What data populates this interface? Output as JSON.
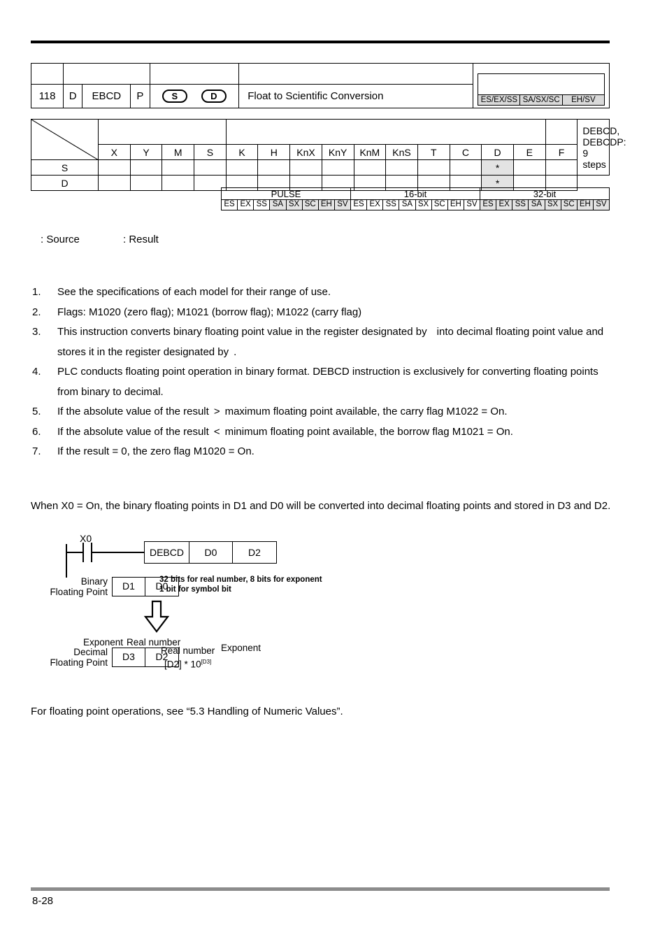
{
  "header": {
    "number": "118",
    "d_flag": "D",
    "mnemonic": "EBCD",
    "p_flag": "P",
    "operand_s": "S",
    "operand_d": "D",
    "description": "Float to Scientific Conversion",
    "model_groups": [
      "ES/EX/SS",
      "SA/SX/SC",
      "EH/SV"
    ]
  },
  "operand_table": {
    "columns": [
      "X",
      "Y",
      "M",
      "S",
      "K",
      "H",
      "KnX",
      "KnY",
      "KnM",
      "KnS",
      "T",
      "C",
      "D",
      "E",
      "F"
    ],
    "steps_note": "DEBCD, DEBCDP: 9 steps",
    "rows": [
      {
        "label": "S",
        "marks": [
          "",
          "",
          "",
          "",
          "",
          "",
          "",
          "",
          "",
          "",
          "",
          "",
          "*",
          "",
          ""
        ]
      },
      {
        "label": "D",
        "marks": [
          "",
          "",
          "",
          "",
          "",
          "",
          "",
          "",
          "",
          "",
          "",
          "",
          "*",
          "",
          ""
        ]
      }
    ]
  },
  "pulse_table": {
    "groups": [
      "PULSE",
      "16-bit",
      "32-bit"
    ],
    "models": [
      "ES",
      "EX",
      "SS",
      "SA",
      "SX",
      "SC",
      "EH",
      "SV"
    ],
    "shading": {
      "PULSE": [
        false,
        false,
        false,
        true,
        true,
        true,
        true,
        true
      ],
      "16-bit": [
        false,
        false,
        false,
        false,
        false,
        false,
        false,
        false
      ],
      "32-bit": [
        true,
        true,
        true,
        true,
        true,
        true,
        true,
        true
      ]
    }
  },
  "legend": {
    "source": ": Source",
    "result": ": Result"
  },
  "notes": [
    {
      "num": "1.",
      "text": "See the specifications of each model for their range of use."
    },
    {
      "num": "2.",
      "text": "Flags: M1020 (zero flag); M1021 (borrow flag); M1022 (carry flag)"
    },
    {
      "num": "3.",
      "text_a": "This instruction converts binary floating point value in the register designated by",
      "text_b": "into decimal floating point value and stores it in the register designated by",
      "text_c": "."
    },
    {
      "num": "4.",
      "text": "PLC conducts floating point operation in binary format. DEBCD instruction is exclusively for converting floating points from binary to decimal."
    },
    {
      "num": "5.",
      "text_a": "If the absolute value of the result",
      "symbol": ">",
      "text_b": "maximum floating point available, the carry flag M1022 = On."
    },
    {
      "num": "6.",
      "text_a": "If the absolute value of the result",
      "symbol": "<",
      "text_b": "minimum floating point available, the borrow flag M1021 = On."
    },
    {
      "num": "7.",
      "text": "If the result = 0, the zero flag M1020 = On."
    }
  ],
  "example": {
    "paragraph": "When X0 = On, the binary floating points in D1 and D0 will be converted into decimal floating points and stored in D3 and D2.",
    "contact_label": "X0",
    "instruction": {
      "opcode": "DEBCD",
      "operand1": "D0",
      "operand2": "D2"
    },
    "binary": {
      "label_line1": "Binary",
      "label_line2": "Floating Point",
      "reg_high": "D1",
      "reg_low": "D0",
      "note_line1": "32 bits for real number, 8 bits for exponent",
      "note_line2": "1 bit for symbol bit"
    },
    "decimal": {
      "label_line1": "Decimal",
      "label_line2": "Floating Point",
      "exponent_label": "Exponent",
      "real_label": "Real number",
      "reg_high": "D3",
      "reg_low": "D2",
      "formula_line1": "Real number",
      "formula_line2": "[D2] * 10",
      "formula_exp": "[D3]",
      "formula_exp_label": "Exponent"
    }
  },
  "footnote": "For floating point operations, see “5.3 Handling of Numeric Values”.",
  "footer": {
    "page_number": "8-28"
  }
}
